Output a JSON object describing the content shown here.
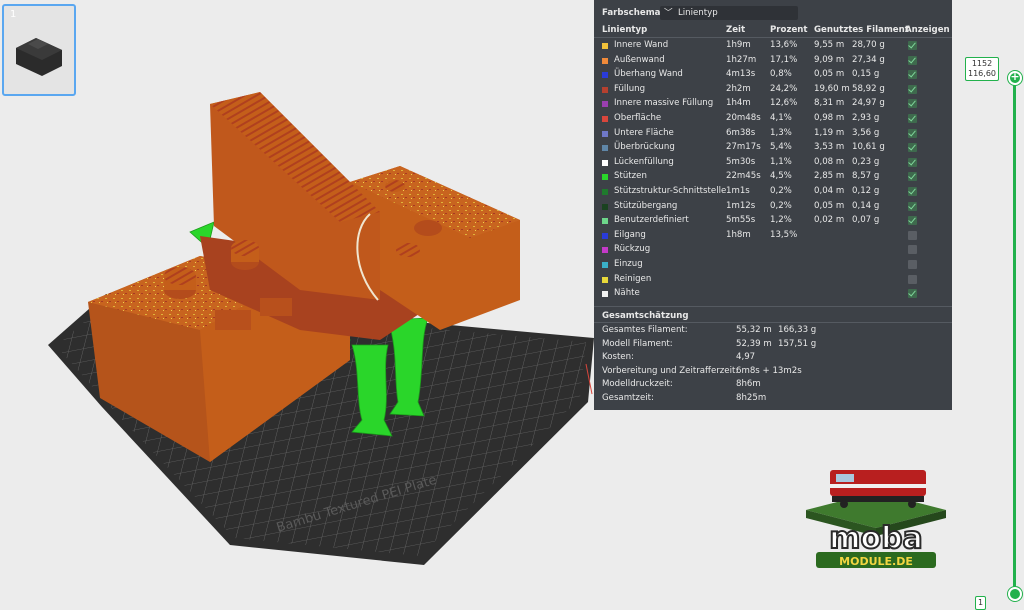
{
  "plate_thumb": {
    "number": "1"
  },
  "plate_text": "Bambu Textured PEI Plate",
  "panel": {
    "scheme_label": "Farbschema",
    "scheme_value": "Linientyp",
    "headers": {
      "type": "Linientyp",
      "time": "Zeit",
      "percent": "Prozent",
      "filament": "Genutztes Filament",
      "show": "Anzeigen"
    },
    "rows": [
      {
        "name": "Innere Wand",
        "color": "#f2c23a",
        "time": "1h9m",
        "percent": "13,6%",
        "m": "9,55 m",
        "g": "28,70 g",
        "show": true,
        "chk": true
      },
      {
        "name": "Außenwand",
        "color": "#f08a3a",
        "time": "1h27m",
        "percent": "17,1%",
        "m": "9,09 m",
        "g": "27,34 g",
        "show": true,
        "chk": true
      },
      {
        "name": "Überhang Wand",
        "color": "#2a3bd8",
        "time": "4m13s",
        "percent": "0,8%",
        "m": "0,05 m",
        "g": "0,15 g",
        "show": true,
        "chk": true
      },
      {
        "name": "Füllung",
        "color": "#b5402f",
        "time": "2h2m",
        "percent": "24,2%",
        "m": "19,60 m",
        "g": "58,92 g",
        "show": true,
        "chk": true
      },
      {
        "name": "Innere massive Füllung",
        "color": "#9a3fb0",
        "time": "1h4m",
        "percent": "12,6%",
        "m": "8,31 m",
        "g": "24,97 g",
        "show": true,
        "chk": true
      },
      {
        "name": "Oberfläche",
        "color": "#d9463c",
        "time": "20m48s",
        "percent": "4,1%",
        "m": "0,98 m",
        "g": "2,93 g",
        "show": true,
        "chk": true
      },
      {
        "name": "Untere Fläche",
        "color": "#6f78c8",
        "time": "6m38s",
        "percent": "1,3%",
        "m": "1,19 m",
        "g": "3,56 g",
        "show": true,
        "chk": true
      },
      {
        "name": "Überbrückung",
        "color": "#5f86a8",
        "time": "27m17s",
        "percent": "5,4%",
        "m": "3,53 m",
        "g": "10,61 g",
        "show": true,
        "chk": true
      },
      {
        "name": "Lückenfüllung",
        "color": "#ffffff",
        "time": "5m30s",
        "percent": "1,1%",
        "m": "0,08 m",
        "g": "0,23 g",
        "show": true,
        "chk": true
      },
      {
        "name": "Stützen",
        "color": "#2ad62a",
        "time": "22m45s",
        "percent": "4,5%",
        "m": "2,85 m",
        "g": "8,57 g",
        "show": true,
        "chk": true
      },
      {
        "name": "Stützstruktur-Schnittstelle",
        "color": "#1f7a2d",
        "time": "1m1s",
        "percent": "0,2%",
        "m": "0,04 m",
        "g": "0,12 g",
        "show": true,
        "chk": true
      },
      {
        "name": "Stützübergang",
        "color": "#1a4220",
        "time": "1m12s",
        "percent": "0,2%",
        "m": "0,05 m",
        "g": "0,14 g",
        "show": true,
        "chk": true
      },
      {
        "name": "Benutzerdefiniert",
        "color": "#6dd68a",
        "time": "5m55s",
        "percent": "1,2%",
        "m": "0,02 m",
        "g": "0,07 g",
        "show": true,
        "chk": true
      },
      {
        "name": "Eilgang",
        "color": "#2a3bd8",
        "time": "1h8m",
        "percent": "13,5%",
        "m": "",
        "g": "",
        "show": false,
        "chk": false
      },
      {
        "name": "Rückzug",
        "color": "#c43ac8",
        "time": "",
        "percent": "",
        "m": "",
        "g": "",
        "show": false,
        "chk": false
      },
      {
        "name": "Einzug",
        "color": "#3ab0c8",
        "time": "",
        "percent": "",
        "m": "",
        "g": "",
        "show": false,
        "chk": false
      },
      {
        "name": "Reinigen",
        "color": "#e8d83a",
        "time": "",
        "percent": "",
        "m": "",
        "g": "",
        "show": false,
        "chk": false
      },
      {
        "name": "Nähte",
        "color": "#f2f2f2",
        "time": "",
        "percent": "",
        "m": "",
        "g": "",
        "show": true,
        "chk": true
      }
    ],
    "estimate_title": "Gesamtschätzung",
    "estimates": [
      {
        "label": "Gesamtes Filament:",
        "v1": "55,32 m",
        "v2": "166,33 g"
      },
      {
        "label": "Modell Filament:",
        "v1": "52,39 m",
        "v2": "157,51 g"
      },
      {
        "label": "Kosten:",
        "v1": "4,97",
        "v2": ""
      },
      {
        "label": "Vorbereitung und Zeitrafferzeit:",
        "v1": "6m8s + 13m2s",
        "v2": ""
      },
      {
        "label": "Modelldruckzeit:",
        "v1": "8h6m",
        "v2": ""
      },
      {
        "label": "Gesamtzeit:",
        "v1": "8h25m",
        "v2": ""
      }
    ]
  },
  "slider": {
    "top_layer": "1152",
    "top_height": "116,60",
    "bottom_layer": "1"
  },
  "logo": {
    "line1": "moba",
    "line2": "MODULE.DE"
  },
  "colors": {
    "accent": "#22b14c",
    "model": "#c9641c",
    "support": "#2ad62a",
    "panel_bg": "#3d4147"
  }
}
